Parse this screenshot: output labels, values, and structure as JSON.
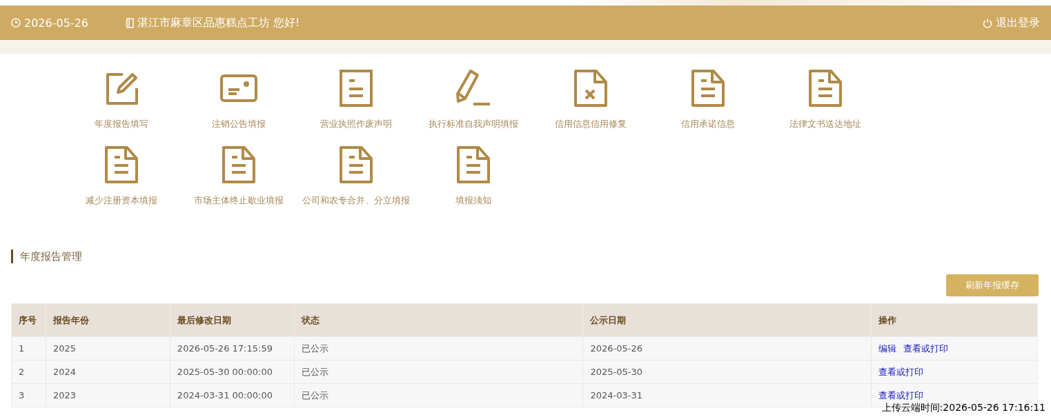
{
  "header": {
    "date": "2026-05-26",
    "greeting": "湛江市麻章区品惠糕点工坊 您好!",
    "logout": "退出登录"
  },
  "menu": [
    {
      "label": "年度报告填写",
      "kind": "edit"
    },
    {
      "label": "注销公告填报",
      "kind": "card"
    },
    {
      "label": "营业执照作废声明",
      "kind": "doc"
    },
    {
      "label": "执行标准自我声明填报",
      "kind": "pencil"
    },
    {
      "label": "信用信息信用修复",
      "kind": "docx"
    },
    {
      "label": "信用承诺信息",
      "kind": "docfold"
    },
    {
      "label": "法律文书送达地址",
      "kind": "docfold"
    },
    {
      "label": "减少注册资本填报",
      "kind": "docfold"
    },
    {
      "label": "市场主体终止歇业填报",
      "kind": "docfold"
    },
    {
      "label": "公司和农专合并、分立填报",
      "kind": "docfold"
    },
    {
      "label": "填报须知",
      "kind": "docfold"
    }
  ],
  "section": {
    "title": "年度报告管理",
    "button": "刷新年报缓存"
  },
  "table": {
    "columns": [
      "序号",
      "报告年份",
      "最后修改日期",
      "状态",
      "公示日期",
      "操作"
    ],
    "rows": [
      {
        "cells": [
          "1",
          "2025",
          "2026-05-26 17:15:59",
          "已公示",
          "2026-05-26"
        ],
        "actions": [
          "编辑",
          "查看或打印"
        ]
      },
      {
        "cells": [
          "2",
          "2024",
          "2025-05-30 00:00:00",
          "已公示",
          "2025-05-30"
        ],
        "actions": [
          "查看或打印"
        ]
      },
      {
        "cells": [
          "3",
          "2023",
          "2024-03-31 00:00:00",
          "已公示",
          "2024-03-31"
        ],
        "actions": [
          "查看或打印"
        ]
      }
    ]
  },
  "upload_time": "上传云端时间:2026-05-26 17:16:11"
}
